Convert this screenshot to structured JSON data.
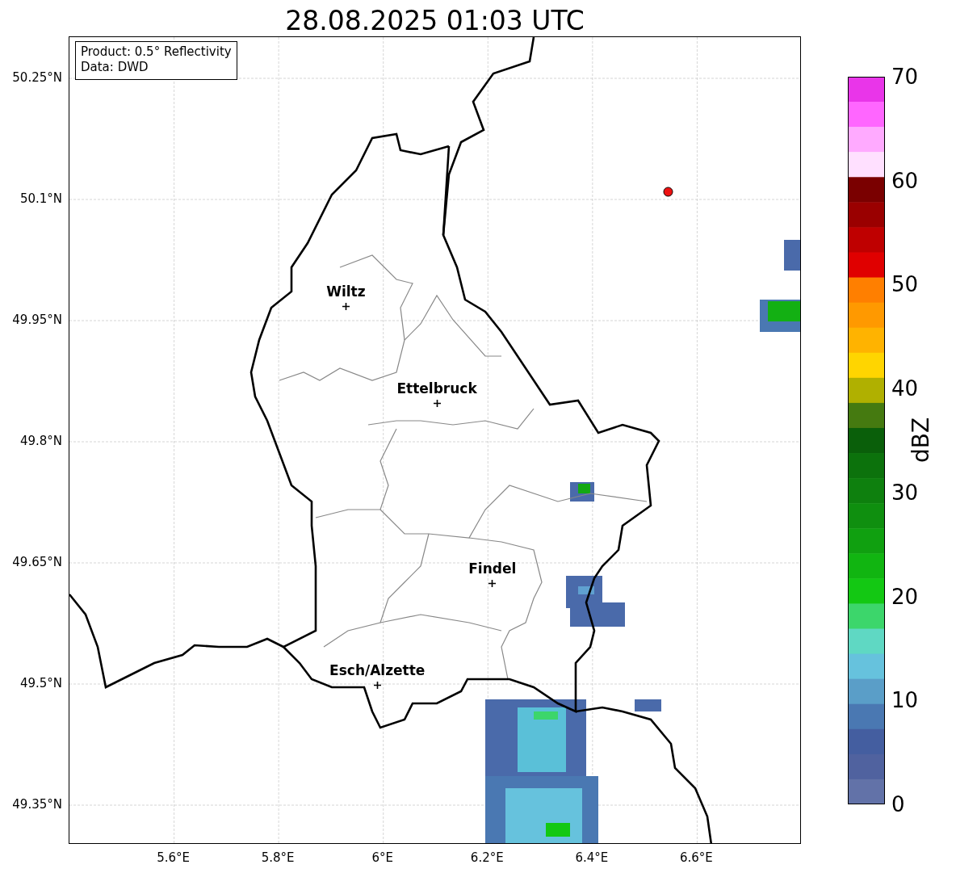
{
  "title": "28.08.2025 01:03 UTC",
  "info_box": [
    "Product: 0.5° Reflectivity",
    "Data: DWD"
  ],
  "map": {
    "xticks": [
      "5.6°E",
      "5.8°E",
      "6°E",
      "6.2°E",
      "6.4°E",
      "6.6°E"
    ],
    "yticks": [
      "50.25°N",
      "50.1°N",
      "49.95°N",
      "49.8°N",
      "49.65°N",
      "49.5°N",
      "49.35°N"
    ],
    "cities": [
      "Wiltz",
      "Ettelbruck",
      "Findel",
      "Esch/Alzette"
    ]
  },
  "colorbar": {
    "label": "dBZ",
    "ticks": [
      "70",
      "60",
      "50",
      "40",
      "30",
      "20",
      "10",
      "0"
    ],
    "segments": [
      {
        "color": "#e935e9"
      },
      {
        "color": "#ff66ff"
      },
      {
        "color": "#ffaaff"
      },
      {
        "color": "#ffe0ff"
      },
      {
        "color": "#7a0000"
      },
      {
        "color": "#9a0000"
      },
      {
        "color": "#bf0000"
      },
      {
        "color": "#e00000"
      },
      {
        "color": "#ff7f00"
      },
      {
        "color": "#ff9900"
      },
      {
        "color": "#ffb300"
      },
      {
        "color": "#ffd500"
      },
      {
        "color": "#b0b000"
      },
      {
        "color": "#457a10"
      },
      {
        "color": "#0a5f0a"
      },
      {
        "color": "#0c720c"
      },
      {
        "color": "#0e800e"
      },
      {
        "color": "#0f8f0f"
      },
      {
        "color": "#10a010"
      },
      {
        "color": "#11b511"
      },
      {
        "color": "#13c813"
      },
      {
        "color": "#3cd66b"
      },
      {
        "color": "#5fd8c3"
      },
      {
        "color": "#66c2dd"
      },
      {
        "color": "#5a9ec8"
      },
      {
        "color": "#4a78b2"
      },
      {
        "color": "#445ea0"
      },
      {
        "color": "#50629f"
      },
      {
        "color": "#6272a8"
      }
    ]
  }
}
